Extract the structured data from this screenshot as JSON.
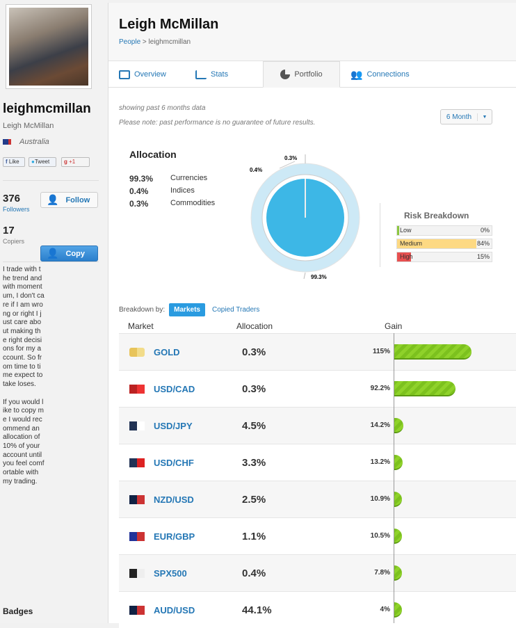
{
  "profile": {
    "username": "leighmcmillan",
    "real_name": "Leigh McMillan",
    "country": "Australia",
    "social": {
      "like": "Like",
      "tweet": "Tweet",
      "plus": "+1"
    },
    "followers": {
      "count": "376",
      "label": "Followers"
    },
    "copiers": {
      "count": "17",
      "label": "Copiers"
    },
    "follow_label": "Follow",
    "copy_label": "Copy",
    "bio": "I trade with the trend and with momentum, I don't care if I am wrong or right I just care about making the right decisions for my account. So from time to time expect to take loses.\n\nIf you would like to copy me I would recommend an allocation of 10% of your account until you feel comfortable with my trading.",
    "badges_label": "Badges"
  },
  "header": {
    "title": "Leigh McMillan",
    "breadcrumb": {
      "root": "People",
      "sep": " > ",
      "current": "leighmcmillan"
    }
  },
  "tabs": [
    {
      "label": "Overview"
    },
    {
      "label": "Stats"
    },
    {
      "label": "Portfolio",
      "active": true
    },
    {
      "label": "Connections"
    }
  ],
  "notes": {
    "period": "showing past 6 months data",
    "disclaimer": "Please note: past performance is no guarantee of future results."
  },
  "period_select": {
    "value": "6 Month"
  },
  "allocation": {
    "title": "Allocation",
    "items": [
      {
        "pct": "99.3%",
        "label": "Currencies"
      },
      {
        "pct": "0.4%",
        "label": "Indices"
      },
      {
        "pct": "0.3%",
        "label": "Commodities"
      }
    ],
    "pie_labels": {
      "a": "0.3%",
      "b": "0.4%",
      "c": "99.3%"
    }
  },
  "chart_data": {
    "type": "pie",
    "title": "Allocation",
    "categories": [
      "Currencies",
      "Indices",
      "Commodities"
    ],
    "values": [
      99.3,
      0.4,
      0.3
    ]
  },
  "risk": {
    "title": "Risk Breakdown",
    "items": [
      {
        "label": "Low",
        "pct": "0%",
        "value": 0,
        "color": "#8cc63f"
      },
      {
        "label": "Medium",
        "pct": "84%",
        "value": 84,
        "color": "#fdd983"
      },
      {
        "label": "High",
        "pct": "15%",
        "value": 15,
        "color": "#e85050"
      }
    ]
  },
  "breakdown": {
    "label": "Breakdown by:",
    "markets": "Markets",
    "copied": "Copied Traders"
  },
  "columns": {
    "market": "Market",
    "allocation": "Allocation",
    "gain": "Gain"
  },
  "rows": [
    {
      "market": "GOLD",
      "allocation": "0.3%",
      "gain": "115%",
      "gain_value": 115,
      "flag": "gold-bar"
    },
    {
      "market": "USD/CAD",
      "allocation": "0.3%",
      "gain": "92.2%",
      "gain_value": 92.2,
      "flag": "us-ca"
    },
    {
      "market": "USD/JPY",
      "allocation": "4.5%",
      "gain": "14.2%",
      "gain_value": 14.2,
      "flag": "us-jp"
    },
    {
      "market": "USD/CHF",
      "allocation": "3.3%",
      "gain": "13.2%",
      "gain_value": 13.2,
      "flag": "us-ch"
    },
    {
      "market": "NZD/USD",
      "allocation": "2.5%",
      "gain": "10.9%",
      "gain_value": 10.9,
      "flag": "nz-us"
    },
    {
      "market": "EUR/GBP",
      "allocation": "1.1%",
      "gain": "10.5%",
      "gain_value": 10.5,
      "flag": "eu-gb"
    },
    {
      "market": "SPX500",
      "allocation": "0.4%",
      "gain": "7.8%",
      "gain_value": 7.8,
      "flag": "usa"
    },
    {
      "market": "AUD/USD",
      "allocation": "44.1%",
      "gain": "4%",
      "gain_value": 4,
      "flag": "au-us"
    }
  ]
}
